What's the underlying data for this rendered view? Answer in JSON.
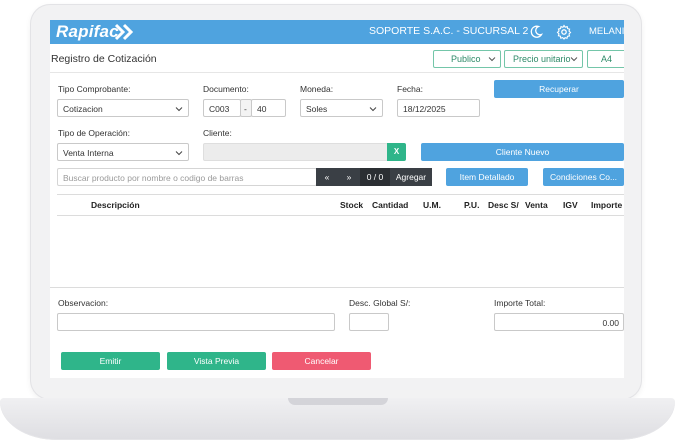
{
  "app": {
    "brand": "Rapifac",
    "company": "SOPORTE S.A.C. - SUCURSAL 2",
    "user": "MELANI"
  },
  "header": {
    "title": "Registro de Cotización",
    "list_select": "Publico",
    "price_select": "Precio unitario",
    "format_select": "A4"
  },
  "form": {
    "tipo_comprobante": {
      "label": "Tipo Comprobante:",
      "value": "Cotizacion"
    },
    "documento": {
      "label": "Documento:",
      "serie": "C003",
      "separator": "-",
      "numero": "40"
    },
    "moneda": {
      "label": "Moneda:",
      "value": "Soles"
    },
    "fecha": {
      "label": "Fecha:",
      "value": "18/12/2025"
    },
    "recuperar_label": "Recuperar",
    "tipo_operacion": {
      "label": "Tipo de Operación:",
      "value": "Venta Interna"
    },
    "cliente": {
      "label": "Cliente:",
      "value": "",
      "clear_label": "X"
    },
    "cliente_nuevo_label": "Cliente Nuevo"
  },
  "search": {
    "placeholder": "Buscar producto por nombre o codigo de barras",
    "prev_label": "«",
    "next_label": "»",
    "page_counter": "0 / 0",
    "add_label": "Agregar",
    "item_detallado_label": "Item Detallado",
    "condiciones_label": "Condiciones Co..."
  },
  "table": {
    "columns": [
      "Descripción",
      "Stock",
      "Cantidad",
      "U.M.",
      "P.U.",
      "Desc S/",
      "Venta",
      "IGV",
      "Importe"
    ],
    "rows": []
  },
  "footer": {
    "observacion_label": "Observacion:",
    "observacion_value": "",
    "desc_global_label": "Desc. Global S/:",
    "desc_global_value": "",
    "importe_total_label": "Importe Total:",
    "importe_total_value": "0.00"
  },
  "actions": {
    "emitir": "Emitir",
    "vista_previa": "Vista Previa",
    "cancelar": "Cancelar"
  },
  "colors": {
    "primary": "#4fa3df",
    "success": "#2fb58a",
    "danger": "#ef5a72",
    "dark": "#3a3f45"
  },
  "icons": {
    "theme": "moon-icon",
    "settings": "gear-icon",
    "dropdown": "chevron-down-icon"
  }
}
